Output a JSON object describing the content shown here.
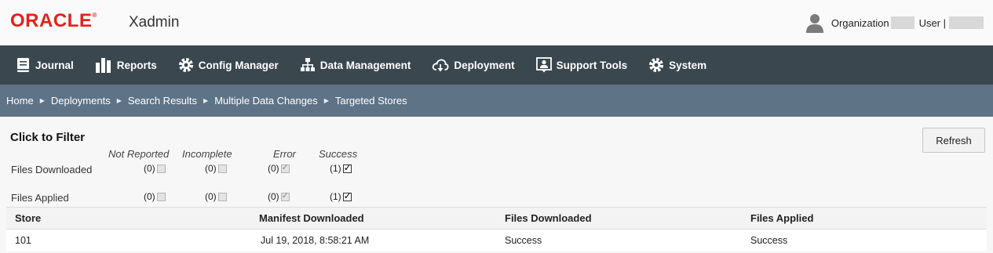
{
  "header": {
    "logo_text": "ORACLE",
    "logo_mark": "®",
    "app_name": "Xadmin",
    "org_label": "Organization",
    "user_label": "User |",
    "user_icon": "user-avatar-icon"
  },
  "nav": {
    "items": [
      {
        "label": "Journal",
        "icon": "journal-icon"
      },
      {
        "label": "Reports",
        "icon": "bar-chart-icon"
      },
      {
        "label": "Config Manager",
        "icon": "gear-icon"
      },
      {
        "label": "Data Management",
        "icon": "hierarchy-icon"
      },
      {
        "label": "Deployment",
        "icon": "cloud-download-icon"
      },
      {
        "label": "Support Tools",
        "icon": "support-icon"
      },
      {
        "label": "System",
        "icon": "gear-icon"
      }
    ]
  },
  "breadcrumb": [
    "Home",
    "Deployments",
    "Search Results",
    "Multiple Data Changes",
    "Targeted Stores"
  ],
  "filter": {
    "title": "Click to Filter",
    "columns": [
      "Not Reported",
      "Incomplete",
      "Error",
      "Success"
    ],
    "rows": [
      {
        "label": "Files Downloaded",
        "counts": [
          "(0)",
          "(0)",
          "(0)",
          "(1)"
        ]
      },
      {
        "label": "Files Applied",
        "counts": [
          "(0)",
          "(0)",
          "(0)",
          "(1)"
        ]
      }
    ]
  },
  "refresh_label": "Refresh",
  "table": {
    "headers": [
      "Store",
      "Manifest Downloaded",
      "Files Downloaded",
      "Files Applied"
    ],
    "rows": [
      [
        "101",
        "Jul 19, 2018, 8:58:21 AM",
        "Success",
        "Success"
      ]
    ]
  },
  "colors": {
    "brand_red": "#e2231a",
    "nav_bg": "#3a474f",
    "breadcrumb_bg": "#5f7387"
  }
}
